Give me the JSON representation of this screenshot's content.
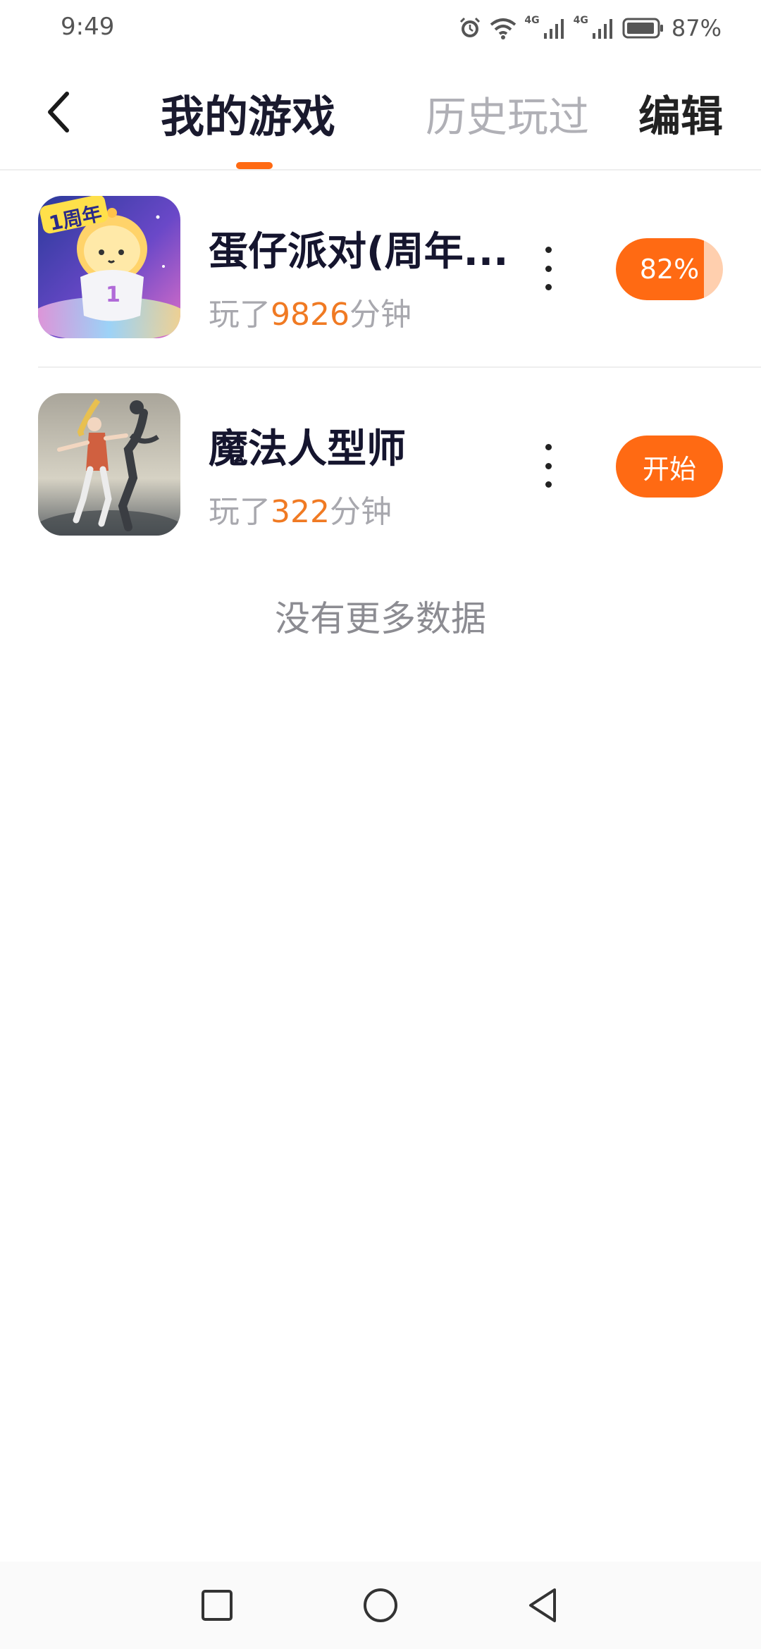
{
  "status_bar": {
    "time": "9:49",
    "network_1": "4G",
    "network_2": "4G",
    "battery": "87%",
    "icons": [
      "alarm-icon",
      "wifi-icon",
      "signal-icon",
      "signal-icon",
      "battery-icon"
    ]
  },
  "header": {
    "tabs": [
      {
        "label": "我的游戏",
        "active": true
      },
      {
        "label": "历史玩过",
        "active": false
      }
    ],
    "edit_label": "编辑",
    "accent_color": "#ff6a13"
  },
  "games": [
    {
      "title": "蛋仔派对(周年...",
      "playtime_prefix": "玩了",
      "playtime_value": "9826",
      "playtime_suffix": "分钟",
      "action_label": "82%",
      "progress": 0.82
    },
    {
      "title": "魔法人型师",
      "playtime_prefix": "玩了",
      "playtime_value": "322",
      "playtime_suffix": "分钟",
      "action_label": "开始"
    }
  ],
  "list_footer": "没有更多数据",
  "nav": {
    "icons": [
      "recent-apps-icon",
      "home-icon",
      "back-icon"
    ]
  }
}
